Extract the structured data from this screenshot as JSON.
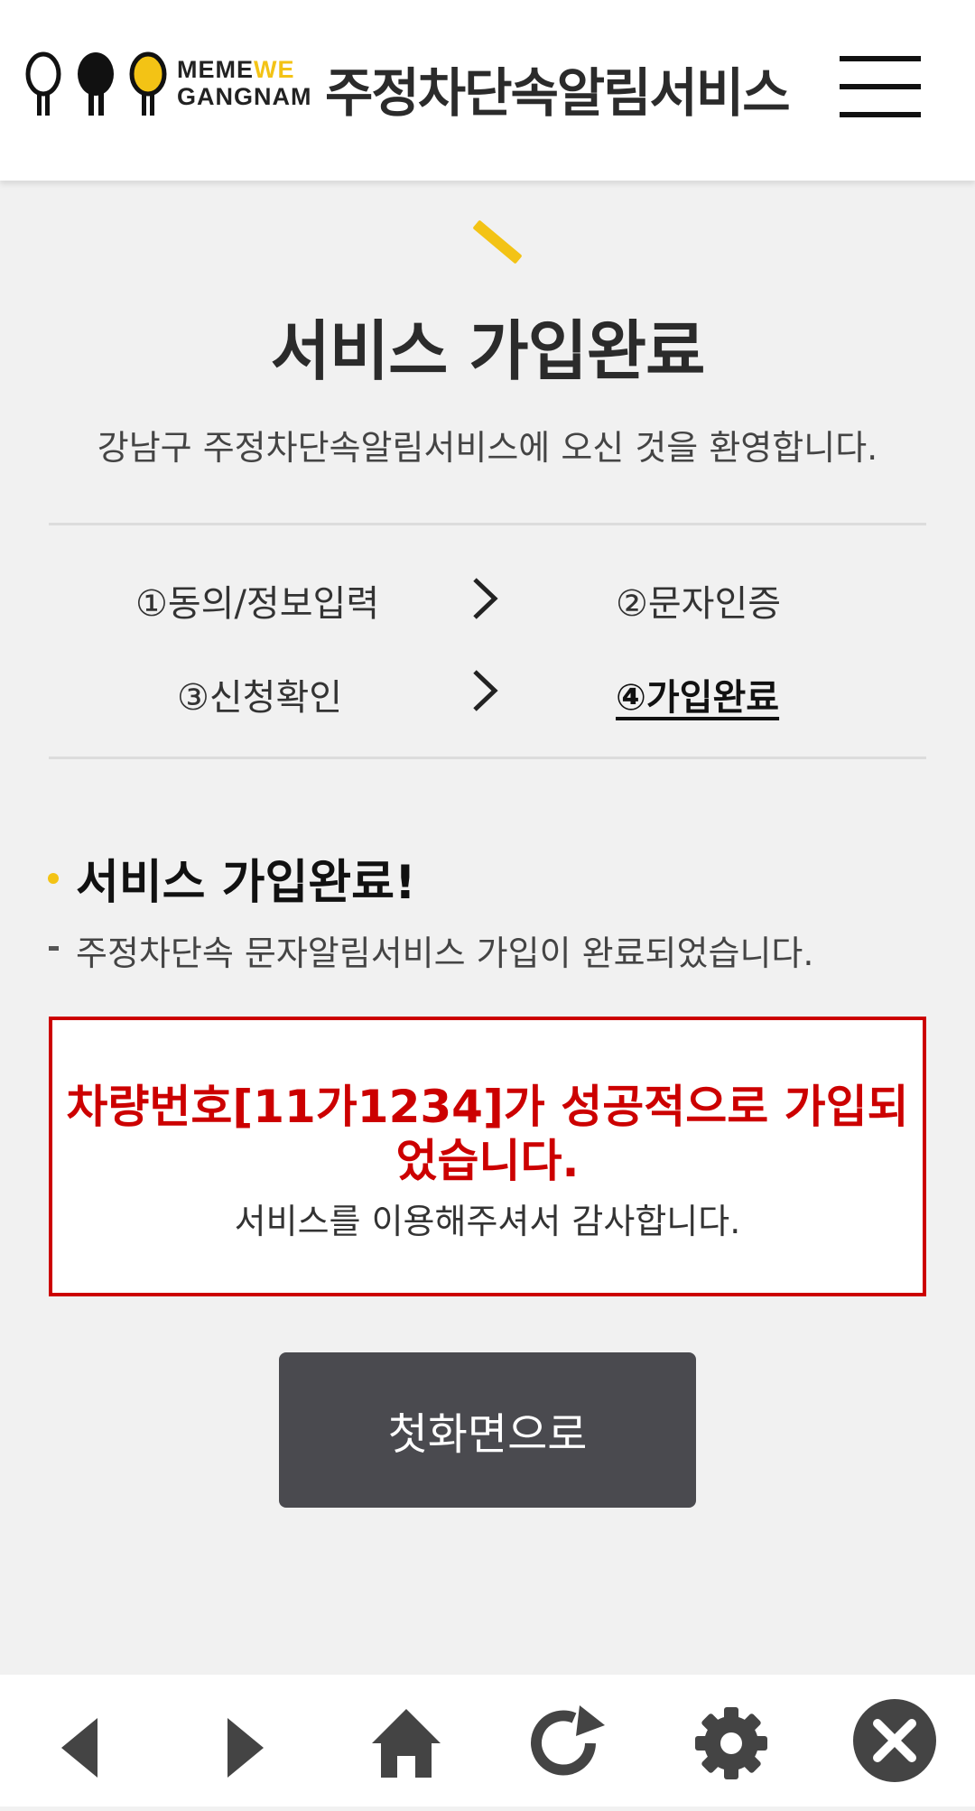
{
  "header": {
    "logo_line1": "MEME",
    "logo_we": "WE",
    "logo_line2": "GANGNAM",
    "service_title": "주정차단속알림서비스",
    "menu_icon": "hamburger-menu-icon"
  },
  "page": {
    "title": "서비스 가입완료",
    "subtitle": "강남구 주정차단속알림서비스에 오신 것을 환영합니다."
  },
  "steps": [
    {
      "label": "①동의/정보입력",
      "active": false
    },
    {
      "label": "②문자인증",
      "active": false
    },
    {
      "label": "③신청확인",
      "active": false
    },
    {
      "label": "④가입완료",
      "active": true
    }
  ],
  "section": {
    "title": "서비스 가입완료!",
    "description": "주정차단속 문자알림서비스 가입이 완료되었습니다."
  },
  "result": {
    "message": "차량번호[11가1234]가 성공적으로 가입되었습니다.",
    "thanks": "서비스를 이용해주셔서 감사합니다."
  },
  "actions": {
    "home_label": "첫화면으로"
  },
  "bottom_nav": [
    "back-arrow-icon",
    "forward-arrow-icon",
    "home-icon",
    "refresh-icon",
    "settings-gear-icon",
    "close-icon"
  ],
  "colors": {
    "accent_yellow": "#f3c315",
    "error_red": "#cc0000",
    "button_dark": "#4a4a4f",
    "background": "#f1f1f1"
  }
}
